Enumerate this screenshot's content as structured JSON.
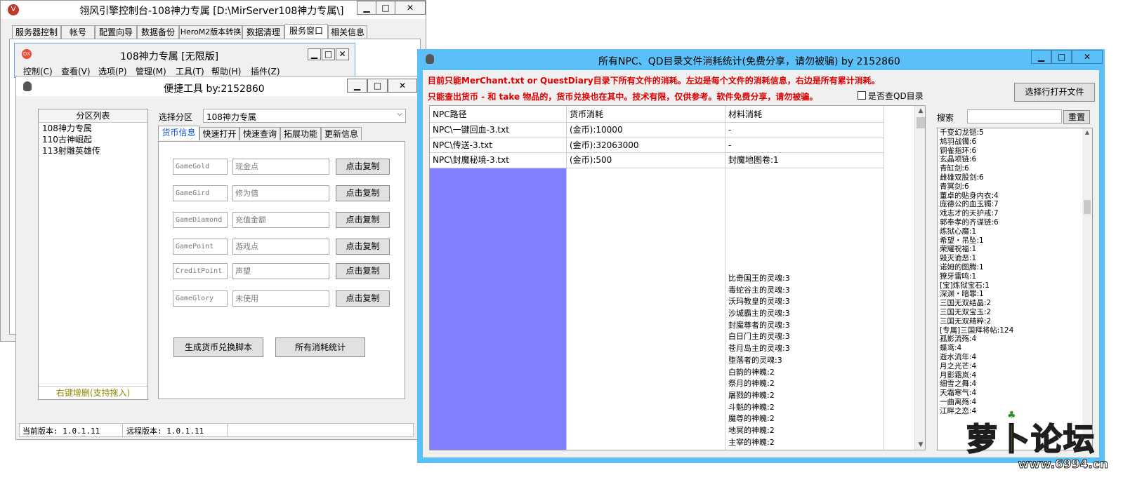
{
  "engine": {
    "title": "翎风引擎控制台-108神力专属 [D:\\MirServer108神力专属\\]",
    "controls": {
      "min": "▁",
      "max": "□",
      "close": "✕"
    },
    "tabs": [
      "服务器控制",
      "帐号",
      "配置向导",
      "数据备份",
      "HeroM2版本转换",
      "数据清理",
      "服务窗口",
      "相关信息"
    ],
    "active_tab": 6
  },
  "server": {
    "title": "108神力专属 [无限版]",
    "menu": [
      "控制(C)",
      "查看(V)",
      "选项(P)",
      "管理(M)",
      "工具(T)",
      "帮助(H)",
      "插件(Z)"
    ]
  },
  "tool": {
    "title": "便捷工具  by:2152860",
    "partition_header": "分区列表",
    "partitions": [
      "108神力专属",
      "110古神崛起",
      "113射雕英雄传"
    ],
    "partition_footer": "右键增删(支持拖入)",
    "select_label": "选择分区",
    "select_value": "108神力专属",
    "tabs": [
      "货币信息",
      "快速打开",
      "快速查询",
      "拓展功能",
      "更新信息"
    ],
    "active_tab": 0,
    "currencies": [
      {
        "code": "GameGold",
        "name": "现金点",
        "button": "点击复制"
      },
      {
        "code": "GameGird",
        "name": "修为值",
        "button": "点击复制"
      },
      {
        "code": "GameDiamond",
        "name": "充值金额",
        "button": "点击复制"
      },
      {
        "code": "GamePoint",
        "name": "游戏点",
        "button": "点击复制"
      },
      {
        "code": "CreditPoint",
        "name": "声望",
        "button": "点击复制"
      },
      {
        "code": "GameGlory",
        "name": "未使用",
        "button": "点击复制"
      }
    ],
    "gen_button": "生成货币兑换脚本",
    "stats_button": "所有消耗统计",
    "status_current": "当前版本: 1.0.1.11",
    "status_remote": "远程版本: 1.0.1.11"
  },
  "stats": {
    "title": "所有NPC、QD目录文件消耗统计(免费分享，请勿被骗)   by 2152860",
    "note1": "目前只能MerChant.txt or QuestDiary目录下所有文件的消耗。左边是每个文件的消耗信息，右边是所有累计消耗。",
    "note2": "只能查出货币 - 和 take 物品的，货币兑换也在其中。技术有限，仅供参考。软件免费分享，请勿被骗。",
    "checkbox_label": "是否查QD目录",
    "open_button": "选择行打开文件",
    "search_label": "搜索",
    "reset_button": "重置",
    "columns": [
      "NPC路径",
      "货币消耗",
      "材料消耗"
    ],
    "rows": [
      {
        "path": "NPC\\一键回血-3.txt",
        "currency": "(金币):10000",
        "material": "-"
      },
      {
        "path": "NPC\\传送-3.txt",
        "currency": "(金币):32063000",
        "material": "-"
      },
      {
        "path": "NPC\\封魔秘境-3.txt",
        "currency": "(金币):500",
        "material": "封魔地图卷:1"
      }
    ],
    "material_lines": [
      "比奇国王的灵魂:3",
      "毒蛇谷主的灵魂:3",
      "沃玛教皇的灵魂:3",
      "沙城霸主的灵魂:3",
      "封魔尊者的灵魂:3",
      "白日门主的灵魂:3",
      "苍月岛主的灵魂:3",
      "堕落者的灵魂:3",
      "白韵的神魄:2",
      "祭月的神魄:2",
      "屠戮的神魄:2",
      "斗魁的神魄:2",
      "魔尊的神魄:2",
      "地冥的神魄:2",
      "主宰的神魄:2"
    ],
    "totals": [
      "千变幻龙铠:5",
      "鸩羽战镯:6",
      "铜雀指环:6",
      "玄晶项链:6",
      "青缸剑:6",
      "雌雄双股剑:6",
      "青冥剑:6",
      "董卓的贴身内衣:4",
      "庞德公的血玉镯:7",
      "戏志才的天护戒:7",
      "郭奉孝的齐谋链:6",
      "炼狱心魔:1",
      "希望・吊坠:1",
      "荣耀祝福:1",
      "毁灭诡恶:1",
      "诺姆的图腾:1",
      "獠牙雷鸣:1",
      "[宝]炼狱宝石:1",
      "深渊・暗罪:1",
      "三国无双结晶:2",
      "三国无双宝玉:2",
      "三国无双精粹:2",
      "[专属]三国拜将帖:124",
      "孤影流殇:4",
      "蝶鸢:4",
      "逝水流年:4",
      "月之光芒:4",
      "月影霜岚:4",
      "细雪之舞:4",
      "天霜寒气:4",
      "一曲离殇:4",
      "江畔之恋:4"
    ]
  },
  "watermark": {
    "logo": "萝卜论坛",
    "url": "www.6994.cn"
  },
  "colors": {
    "accent": "#5bc0f8",
    "highlight": "#8080ff",
    "note": "#e00000",
    "logo_orange": "#f29d1e"
  }
}
